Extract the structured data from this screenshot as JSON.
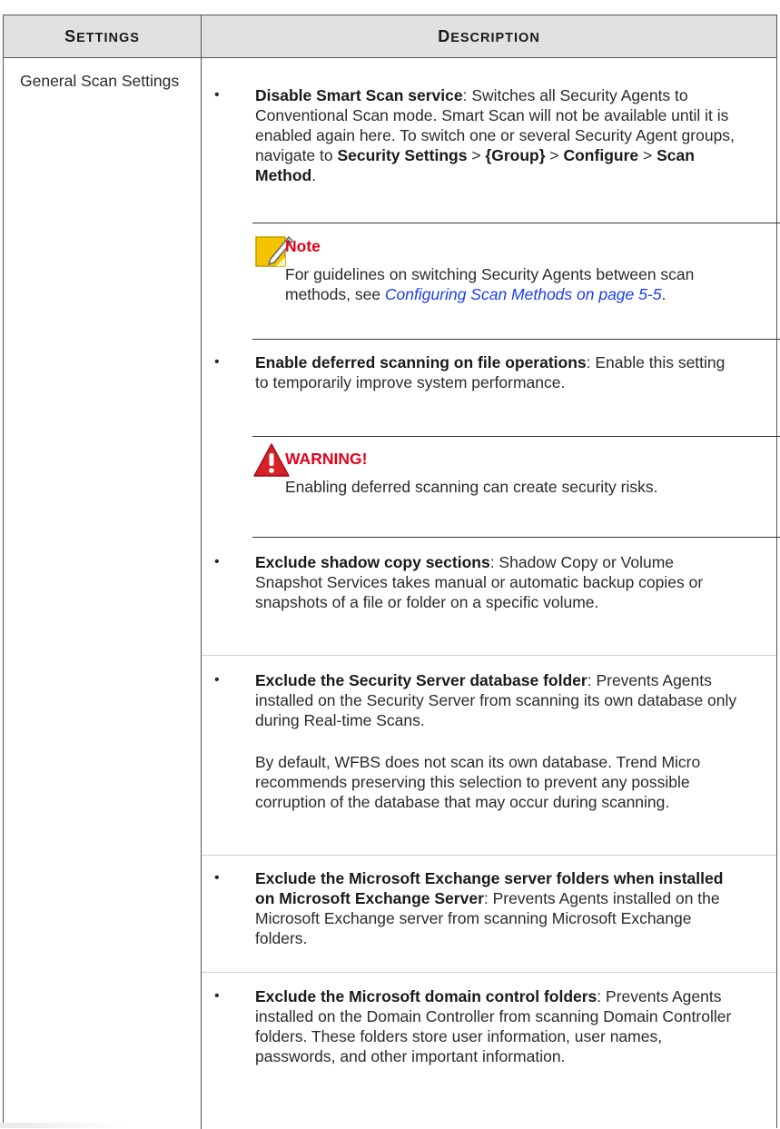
{
  "table": {
    "header": {
      "settings_cap": "S",
      "settings_rest": "ETTINGS",
      "description_cap": "D",
      "description_rest": "ESCRIPTION"
    },
    "row": {
      "setting": "General Scan Settings",
      "bullet_glyph": "•",
      "items": [
        {
          "bold": "Disable Smart Scan service",
          "text": ": Switches all Security Agents to Conventional Scan mode. Smart Scan will not be available until it is enabled again here. To switch one or several Security Agent groups, navigate to ",
          "nav": [
            "Security Settings",
            " > ",
            "{Group}",
            " > ",
            "Configure",
            " > ",
            "Scan Method",
            "."
          ]
        },
        {
          "bold": "Enable deferred scanning on file operations",
          "text": ": Enable this setting to temporarily improve system performance."
        },
        {
          "bold": "Exclude shadow copy sections",
          "text": ": Shadow Copy or Volume Snapshot Services takes manual or automatic backup copies or snapshots of a file or folder on a specific volume."
        },
        {
          "bold": "Exclude the Security Server database folder",
          "text": ": Prevents Agents installed on the Security Server from scanning its own database only during Real-time Scans.",
          "extra": "By default, WFBS does not scan its own database. Trend Micro recommends preserving this selection to prevent any possible corruption of the database that may occur during scanning."
        },
        {
          "bold": "Exclude the Microsoft Exchange server folders when installed on Microsoft Exchange Server",
          "text": ": Prevents Agents installed on the Microsoft Exchange server from scanning Microsoft Exchange folders."
        },
        {
          "bold": "Exclude the Microsoft domain control folders",
          "text": ": Prevents Agents installed on the Domain Controller from scanning Domain Controller folders. These folders store user information, user names, passwords, and other important information."
        }
      ]
    },
    "note": {
      "icon": "note-pencil-icon",
      "title": "Note",
      "text": "For guidelines on switching Security Agents between scan methods, see ",
      "link": "Configuring Scan Methods on page 5-5",
      "after": "."
    },
    "warning": {
      "icon": "warning-triangle-icon",
      "title": "WARNING!",
      "text": "Enabling deferred scanning can create security risks."
    }
  },
  "colors": {
    "header_bg": "#e1e1e1",
    "note_title": "#e3001b",
    "link": "#1c3ee8",
    "note_icon": "#f5c400",
    "warning_icon": "#d7202a"
  }
}
